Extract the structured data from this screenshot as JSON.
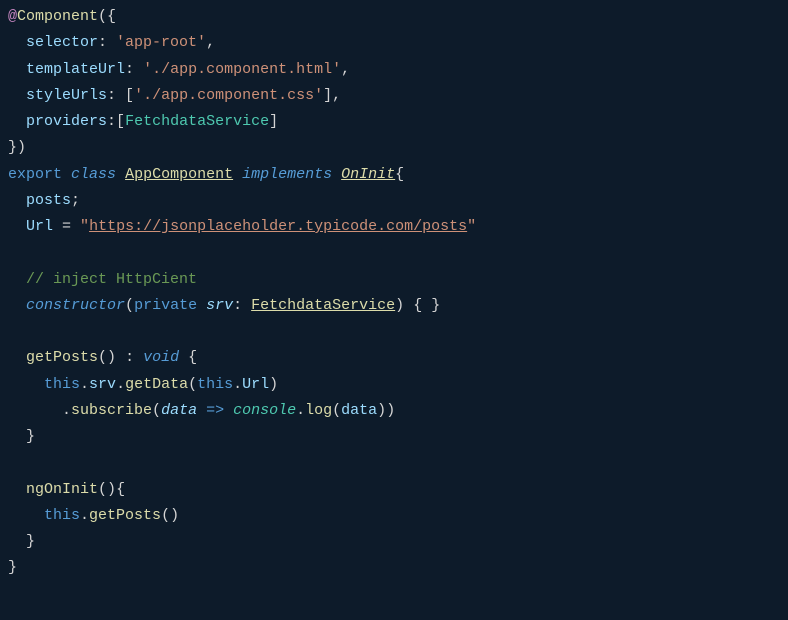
{
  "code": {
    "decorator": "@",
    "component": "Component",
    "paren_open": "(",
    "brace_open": "{",
    "selector_key": "selector",
    "colon": ": ",
    "selector_val": "'app-root'",
    "comma": ",",
    "templateUrl_key": "templateUrl",
    "templateUrl_val": "'./app.component.html'",
    "styleUrls_key": "styleUrls",
    "bracket_open": "[",
    "styleUrls_val": "'./app.component.css'",
    "bracket_close": "]",
    "providers_key": "providers",
    "fetchdata": "FetchdataService",
    "brace_close": "}",
    "paren_close": ")",
    "export": "export",
    "class": "class",
    "appcomponent": "AppComponent",
    "implements": "implements",
    "oninit": "OnInit",
    "posts": "posts",
    "semi": ";",
    "url_var": "Url",
    "equals": " = ",
    "quote": "\"",
    "url_val": "https://jsonplaceholder.typicode.com/posts",
    "comment": "// inject HttpCient",
    "constructor": "constructor",
    "private": "private",
    "srv": "srv",
    "brace_pair": "{ }",
    "getposts": "getPosts",
    "void": "void",
    "this": "this",
    "dot": ".",
    "getdata": "getData",
    "subscribe": "subscribe",
    "data": "data",
    "arrow": " => ",
    "console": "console",
    "log": "log",
    "ngoninit": "ngOnInit"
  }
}
